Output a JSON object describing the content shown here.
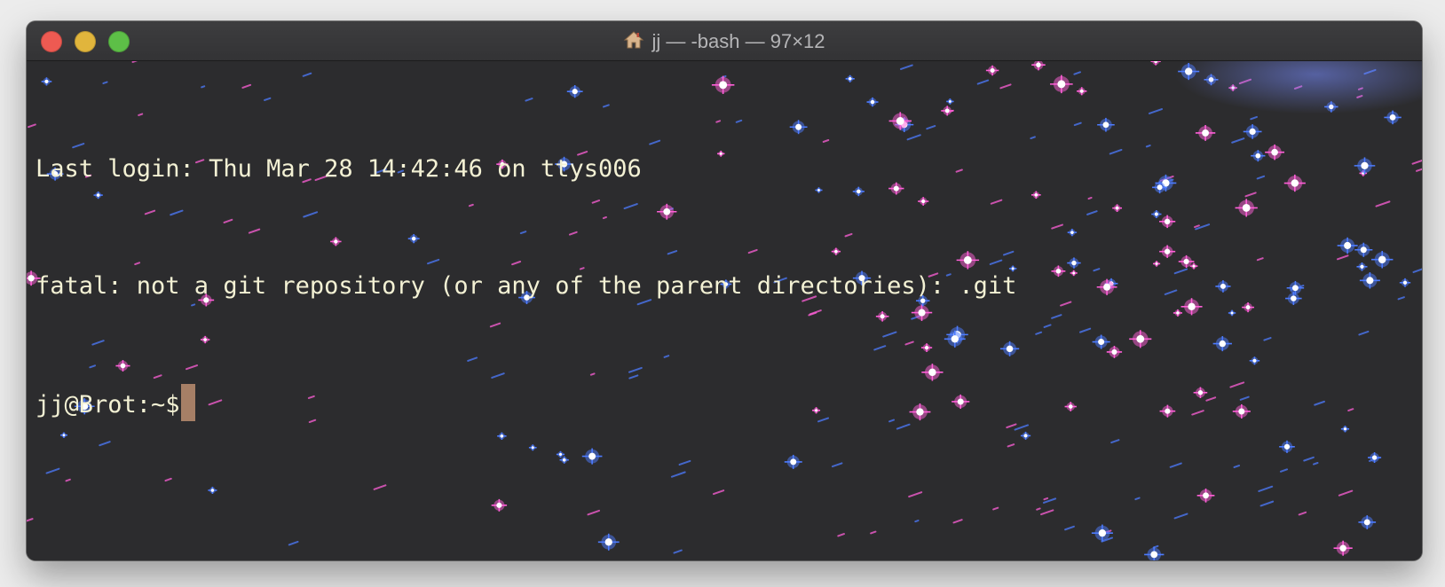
{
  "window": {
    "title": "jj — -bash — 97×12",
    "title_icon": "home-icon"
  },
  "terminal": {
    "lines": [
      "Last login: Thu Mar 28 14:42:46 on ttys006",
      "fatal: not a git repository (or any of the parent directories): .git"
    ],
    "prompt": "jj@Brot:~$",
    "colors": {
      "text": "#f3f1d4",
      "cursor": "#a67f66",
      "background": "#2c2c2e",
      "star_blue": "#4d7bff",
      "star_pink": "#ff5fd8"
    }
  }
}
